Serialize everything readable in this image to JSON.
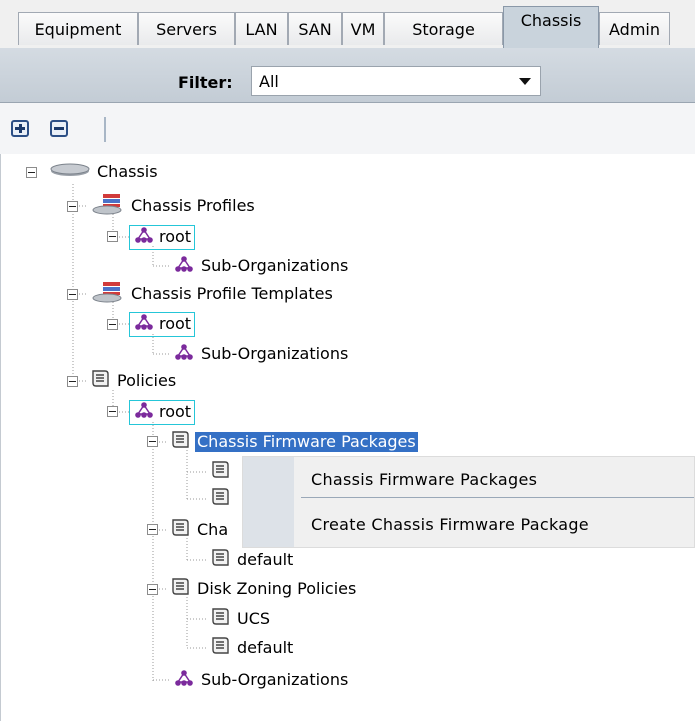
{
  "tabs": [
    {
      "label": "Equipment",
      "active": false
    },
    {
      "label": "Servers",
      "active": false
    },
    {
      "label": "LAN",
      "active": false
    },
    {
      "label": "SAN",
      "active": false
    },
    {
      "label": "VM",
      "active": false
    },
    {
      "label": "Storage",
      "active": false
    },
    {
      "label": "Chassis",
      "active": true
    },
    {
      "label": "Admin",
      "active": false
    }
  ],
  "filter": {
    "label": "Filter:",
    "value": "All"
  },
  "toolbar": {
    "expand_icon": "plus-icon",
    "collapse_icon": "minus-icon"
  },
  "tree": {
    "root": "Chassis",
    "chassis_profiles": "Chassis Profiles",
    "chassis_profiles_root": "root",
    "chassis_profiles_suborgs": "Sub-Organizations",
    "chassis_profile_templates": "Chassis Profile Templates",
    "templates_root": "root",
    "templates_suborgs": "Sub-Organizations",
    "policies": "Policies",
    "policies_root": "root",
    "firmware_packages": "Chassis Firmware Packages",
    "cha_partial": "Cha",
    "cha_default": "default",
    "disk_zoning": "Disk Zoning Policies",
    "disk_ucs": "UCS",
    "disk_default": "default",
    "policies_suborgs": "Sub-Organizations"
  },
  "context_menu": {
    "items": [
      "Chassis Firmware Packages",
      "Create Chassis Firmware Package"
    ]
  },
  "colors": {
    "selection": "#3470c5",
    "focus_box": "#25c6d8",
    "org_icon": "#7b2a9c",
    "tab_active": "#c9d3dc"
  }
}
